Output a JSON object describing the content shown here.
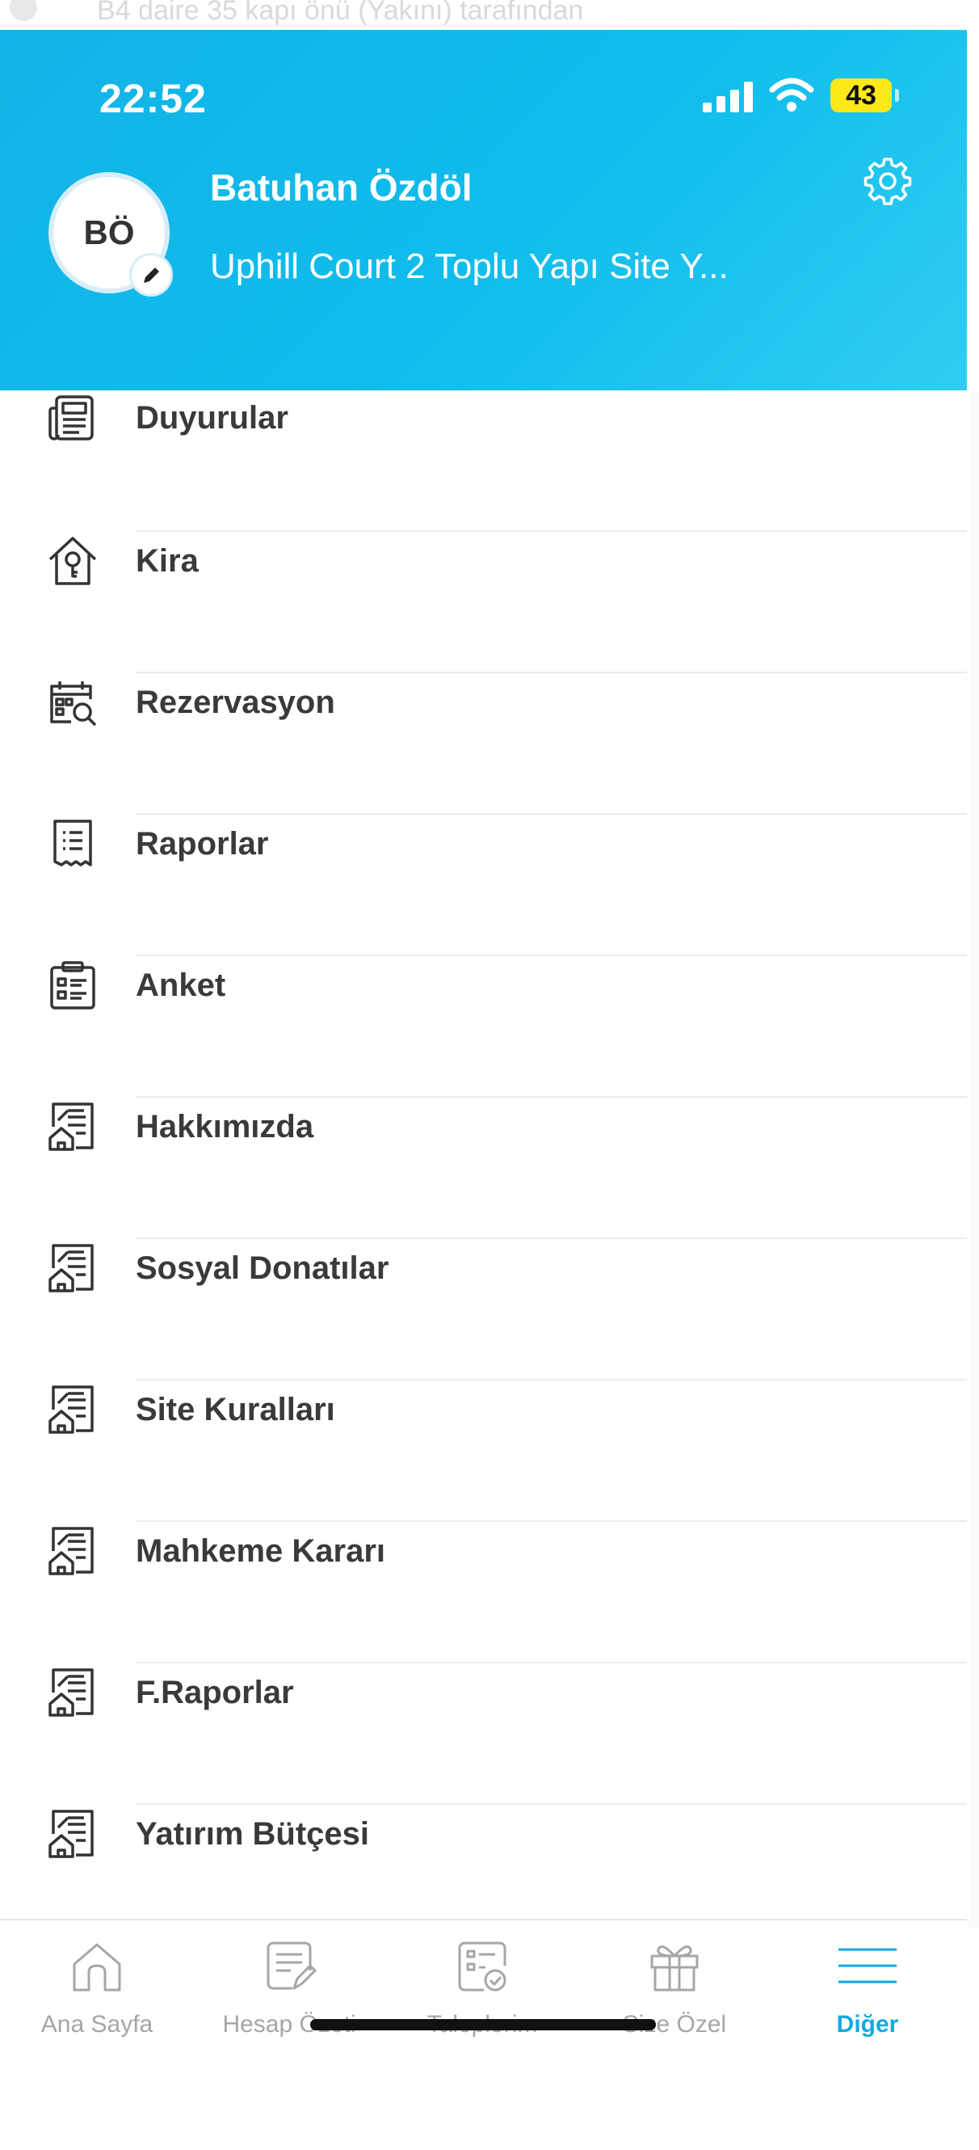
{
  "background": {
    "peek_text": "B4 daire 35 kapı önü (Yakını) tarafından"
  },
  "status_bar": {
    "time": "22:52",
    "battery": "43"
  },
  "header": {
    "avatar_initials": "BÖ",
    "user_name": "Batuhan Özdöl",
    "site_name": "Uphill Court 2 Toplu Yapı Site Y...",
    "settings_icon": "gear-icon",
    "edit_icon": "pencil-icon"
  },
  "menu": [
    {
      "label": "Duyurular",
      "icon": "newspaper-icon"
    },
    {
      "label": "Kira",
      "icon": "house-key-icon"
    },
    {
      "label": "Rezervasyon",
      "icon": "calendar-search-icon"
    },
    {
      "label": "Raporlar",
      "icon": "receipt-icon"
    },
    {
      "label": "Anket",
      "icon": "clipboard-icon"
    },
    {
      "label": "Hakkımızda",
      "icon": "document-house-icon"
    },
    {
      "label": "Sosyal Donatılar",
      "icon": "document-house-icon"
    },
    {
      "label": "Site Kuralları",
      "icon": "document-house-icon"
    },
    {
      "label": "Mahkeme Kararı",
      "icon": "document-house-icon"
    },
    {
      "label": "F.Raporlar",
      "icon": "document-house-icon"
    },
    {
      "label": "Yatırım Bütçesi",
      "icon": "document-house-icon"
    }
  ],
  "tabs": [
    {
      "label": "Ana Sayfa",
      "icon": "home-icon",
      "active": false
    },
    {
      "label": "Hesap Özeti",
      "icon": "notes-icon",
      "active": false
    },
    {
      "label": "Taleplerim",
      "icon": "checklist-icon",
      "active": false
    },
    {
      "label": "Size Özel",
      "icon": "gift-icon",
      "active": false
    },
    {
      "label": "Diğer",
      "icon": "menu-icon",
      "active": true
    }
  ],
  "colors": {
    "header": "#12b3e6",
    "accent": "#12a9df",
    "battery": "#ffe81a"
  }
}
